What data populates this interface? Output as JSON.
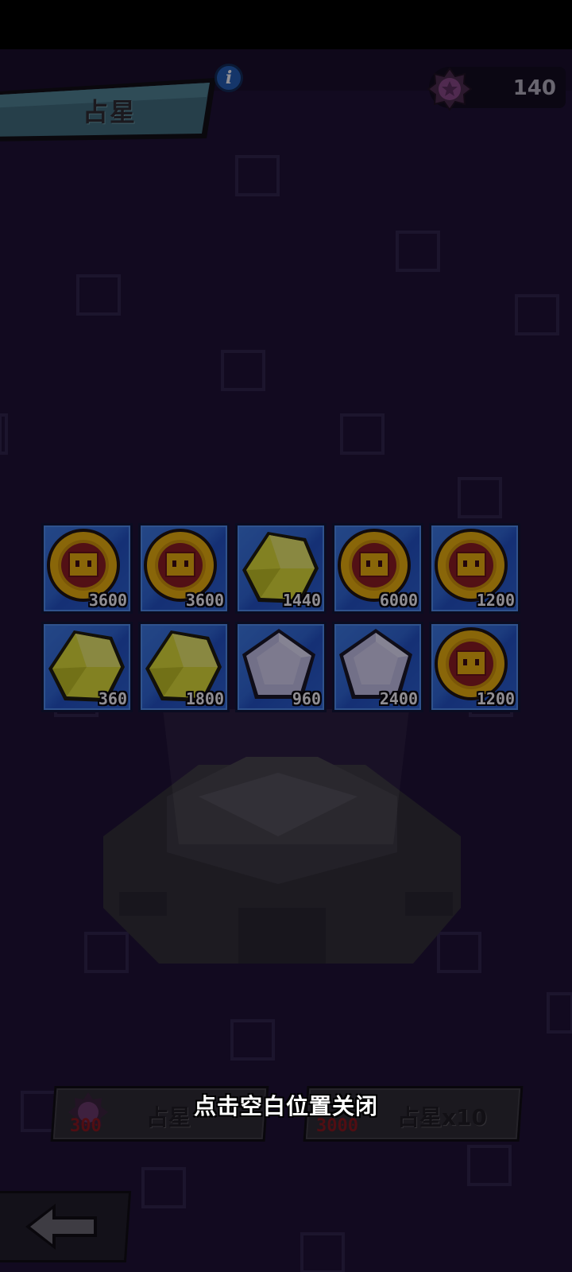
{
  "header": {
    "title": "占星",
    "info_icon": "info-icon",
    "currency": {
      "icon": "star-badge-icon",
      "value": "140",
      "color": "#8a4a86"
    }
  },
  "rewards": [
    {
      "type": "coin",
      "icon": "coin-icon",
      "amount": "3600"
    },
    {
      "type": "coin",
      "icon": "coin-icon",
      "amount": "3600"
    },
    {
      "type": "yellow-gem",
      "icon": "yellow-gem-icon",
      "amount": "1440"
    },
    {
      "type": "coin",
      "icon": "coin-icon",
      "amount": "6000"
    },
    {
      "type": "coin",
      "icon": "coin-icon",
      "amount": "1200"
    },
    {
      "type": "yellow-gem",
      "icon": "yellow-gem-icon",
      "amount": "360"
    },
    {
      "type": "yellow-gem",
      "icon": "yellow-gem-icon",
      "amount": "1800"
    },
    {
      "type": "white-gem",
      "icon": "white-gem-icon",
      "amount": "960"
    },
    {
      "type": "white-gem",
      "icon": "white-gem-icon",
      "amount": "2400"
    },
    {
      "type": "coin",
      "icon": "coin-icon",
      "amount": "1200"
    }
  ],
  "actions": {
    "single": {
      "label": "占星",
      "cost": "300"
    },
    "multi": {
      "label": "占星x10",
      "cost": "3000"
    }
  },
  "close_hint": "点击空白位置关闭",
  "back_icon": "back-arrow-icon",
  "colors": {
    "background": "#1a0f2e",
    "tile_blue": "#2d6ad9",
    "coin_gold": "#f2b705",
    "coin_red": "#8e1b1b",
    "gem_yellow": "#e6e832",
    "gem_white": "#c9c8ec"
  }
}
